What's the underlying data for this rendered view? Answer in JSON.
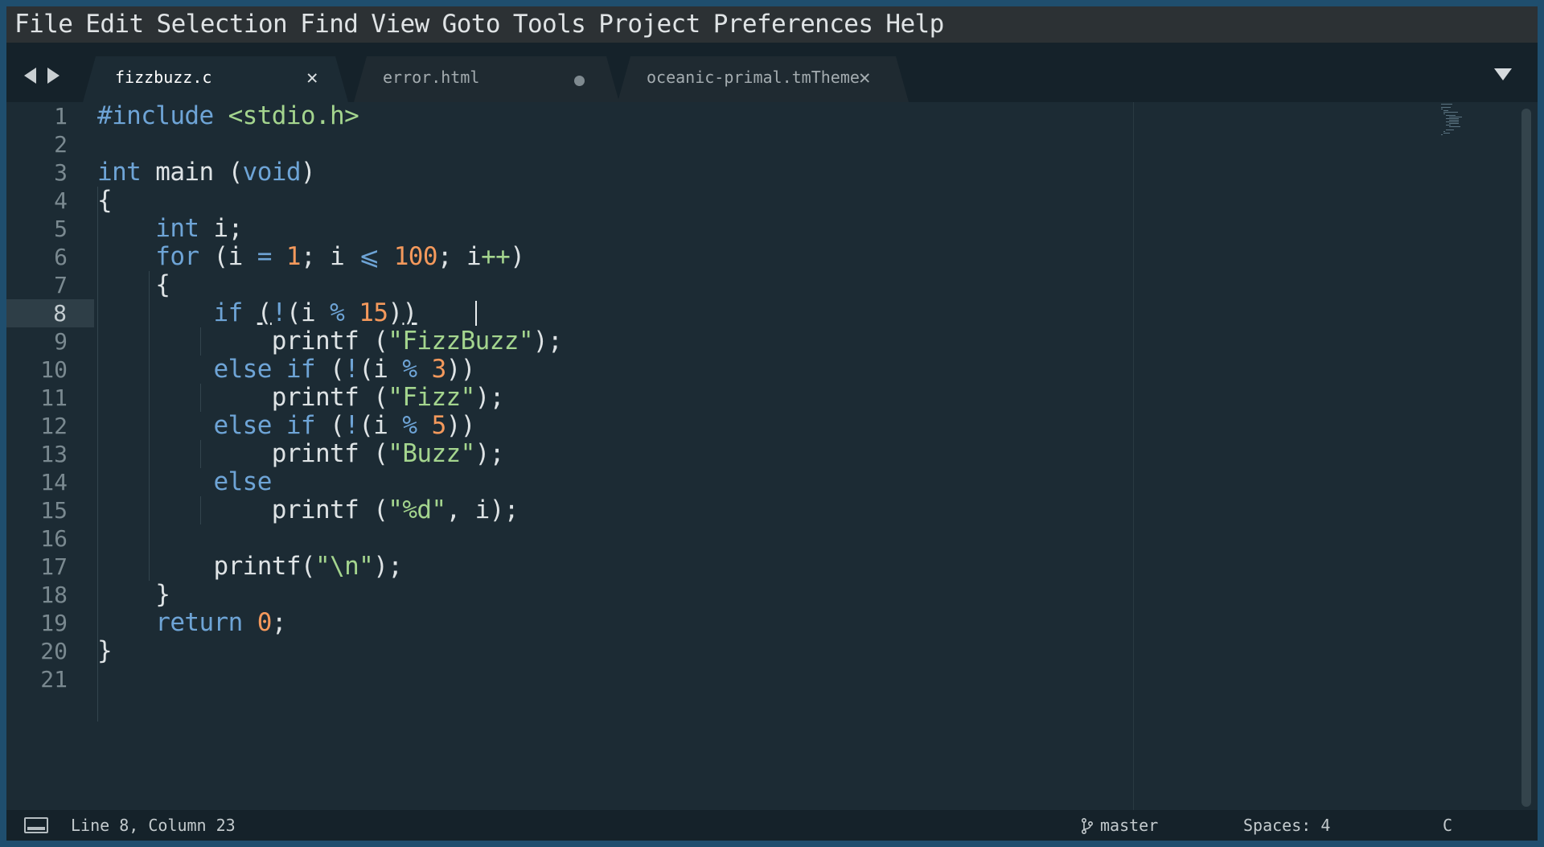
{
  "menu": [
    "File",
    "Edit",
    "Selection",
    "Find",
    "View",
    "Goto",
    "Tools",
    "Project",
    "Preferences",
    "Help"
  ],
  "tabs": [
    {
      "label": "fizzbuzz.c",
      "active": true,
      "modified": false
    },
    {
      "label": "error.html",
      "active": false,
      "modified": true
    },
    {
      "label": "oceanic-primal.tmTheme",
      "active": false,
      "modified": false
    }
  ],
  "editor": {
    "line_numbers": [
      "1",
      "2",
      "3",
      "4",
      "5",
      "6",
      "7",
      "8",
      "9",
      "10",
      "11",
      "12",
      "13",
      "14",
      "15",
      "16",
      "17",
      "18",
      "19",
      "20",
      "21"
    ],
    "current_line": 8
  },
  "status": {
    "position": "Line 8, Column 23",
    "branch": "master",
    "indentation": "Spaces: 4",
    "syntax": "C"
  },
  "colors": {
    "keyword": "#6ea4d6",
    "number": "#f4995c",
    "string": "#a4d58e",
    "background": "#1c2b34"
  }
}
